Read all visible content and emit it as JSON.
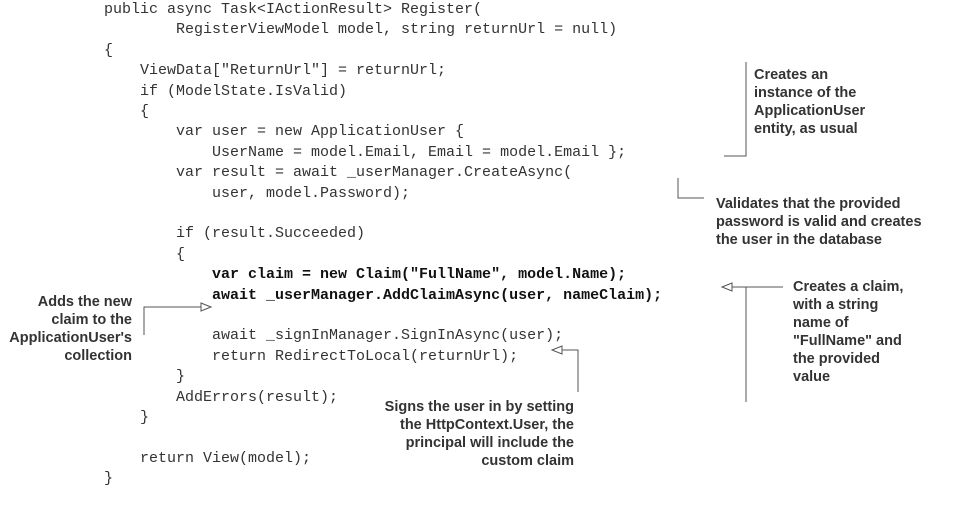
{
  "code_lines": [
    {
      "text": "public async Task<IActionResult> Register(",
      "bold": false
    },
    {
      "text": "        RegisterViewModel model, string returnUrl = null)",
      "bold": false
    },
    {
      "text": "{",
      "bold": false
    },
    {
      "text": "    ViewData[\"ReturnUrl\"] = returnUrl;",
      "bold": false
    },
    {
      "text": "    if (ModelState.IsValid)",
      "bold": false
    },
    {
      "text": "    {",
      "bold": false
    },
    {
      "text": "        var user = new ApplicationUser {",
      "bold": false
    },
    {
      "text": "            UserName = model.Email, Email = model.Email };",
      "bold": false
    },
    {
      "text": "        var result = await _userManager.CreateAsync(",
      "bold": false
    },
    {
      "text": "            user, model.Password);",
      "bold": false
    },
    {
      "text": "",
      "bold": false
    },
    {
      "text": "        if (result.Succeeded)",
      "bold": false
    },
    {
      "text": "        {",
      "bold": false
    },
    {
      "text": "            var claim = new Claim(\"FullName\", model.Name);",
      "bold": true
    },
    {
      "text": "            await _userManager.AddClaimAsync(user, nameClaim);",
      "bold": true
    },
    {
      "text": "",
      "bold": false
    },
    {
      "text": "            await _signInManager.SignInAsync(user);",
      "bold": false
    },
    {
      "text": "            return RedirectToLocal(returnUrl);",
      "bold": false
    },
    {
      "text": "        }",
      "bold": false
    },
    {
      "text": "        AddErrors(result);",
      "bold": false
    },
    {
      "text": "    }",
      "bold": false
    },
    {
      "text": "",
      "bold": false
    },
    {
      "text": "    return View(model);",
      "bold": false
    },
    {
      "text": "}",
      "bold": false
    }
  ],
  "annotations": {
    "create_user": "Creates an\ninstance of the\nApplicationUser\nentity, as usual",
    "validate_password": "Validates that the provided\npassword is valid and creates\nthe user in the database",
    "create_claim": "Creates a claim,\nwith a string\nname of\n\"FullName\" and\nthe provided\nvalue",
    "add_claim": "Adds the new\nclaim to the\nApplicationUser's\ncollection",
    "sign_in": "Signs the user in by setting\nthe HttpContext.User, the\nprincipal will include the\ncustom claim"
  }
}
